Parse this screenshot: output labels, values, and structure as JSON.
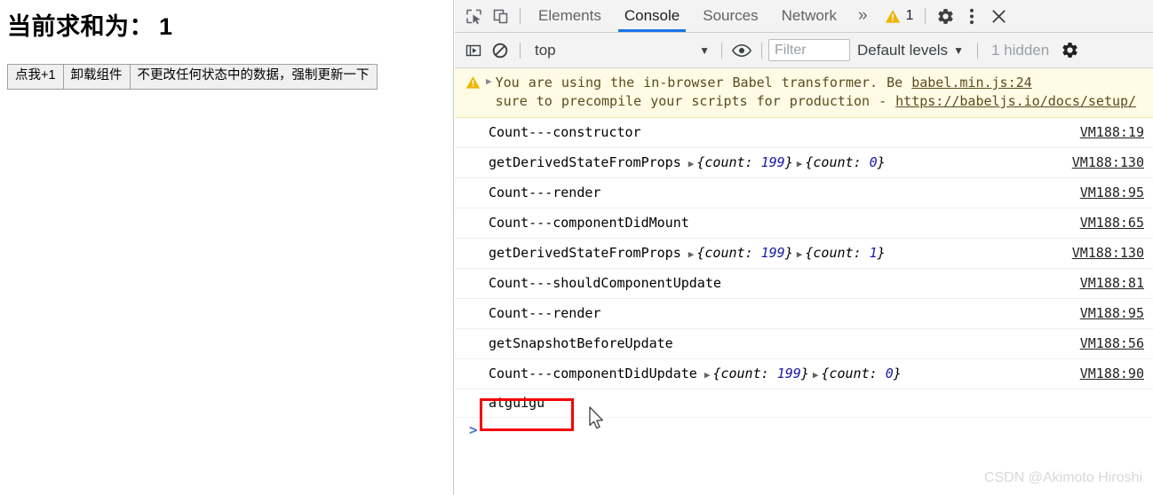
{
  "page": {
    "heading_label": "当前求和为：",
    "heading_value": "1",
    "buttons": [
      {
        "label": "点我+1",
        "name": "increment-button"
      },
      {
        "label": "卸载组件",
        "name": "unmount-component-button"
      },
      {
        "label": "不更改任何状态中的数据，强制更新一下",
        "name": "force-update-button"
      }
    ]
  },
  "devtools": {
    "tabs": [
      {
        "label": "Elements",
        "active": false
      },
      {
        "label": "Console",
        "active": true
      },
      {
        "label": "Sources",
        "active": false
      },
      {
        "label": "Network",
        "active": false
      }
    ],
    "more_tabs_glyph": "»",
    "warning_badge_count": "1",
    "icons": {
      "inspect": "inspect-element-icon",
      "device": "device-toolbar-icon",
      "warning": "warning-triangle-icon",
      "settings": "gear-icon",
      "kebab": "more-options-icon",
      "close": "close-icon",
      "sidebar": "console-sidebar-icon",
      "clear": "clear-console-icon",
      "eye": "live-expression-icon"
    },
    "filterbar": {
      "context_value": "top",
      "context_caret": "▼",
      "filter_placeholder": "Filter",
      "filter_value": "",
      "levels_label": "Default levels",
      "levels_caret": "▼",
      "hidden_label": "1 hidden"
    },
    "colors": {
      "accent": "#1a73e8",
      "warning_bg": "#fffbe5",
      "warning_icon": "#f0b400",
      "annotation": "#f40000",
      "number": "#1a1aa6",
      "prompt": "#4a76c4"
    },
    "messages": [
      {
        "type": "warning",
        "text_part1": "You are using the in-browser Babel transformer. Be",
        "text_part2": "sure to precompile your scripts for production - ",
        "link": "https://babeljs.io/docs/setup/",
        "source": "babel.min.js:24"
      },
      {
        "type": "log",
        "label": "Count---constructor",
        "objects": [],
        "source": "VM188:19"
      },
      {
        "type": "log",
        "label": "getDerivedStateFromProps",
        "objects": [
          {
            "key": "count",
            "value": "199"
          },
          {
            "key": "count",
            "value": "0"
          }
        ],
        "source": "VM188:130"
      },
      {
        "type": "log",
        "label": "Count---render",
        "objects": [],
        "source": "VM188:95"
      },
      {
        "type": "log",
        "label": "Count---componentDidMount",
        "objects": [],
        "source": "VM188:65"
      },
      {
        "type": "log",
        "label": "getDerivedStateFromProps",
        "objects": [
          {
            "key": "count",
            "value": "199"
          },
          {
            "key": "count",
            "value": "1"
          }
        ],
        "source": "VM188:130"
      },
      {
        "type": "log",
        "label": "Count---shouldComponentUpdate",
        "objects": [],
        "source": "VM188:81"
      },
      {
        "type": "log",
        "label": "Count---render",
        "objects": [],
        "source": "VM188:95"
      },
      {
        "type": "log",
        "label": "getSnapshotBeforeUpdate",
        "objects": [],
        "source": "VM188:56"
      },
      {
        "type": "log",
        "label": "Count---componentDidUpdate",
        "objects": [
          {
            "key": "count",
            "value": "199"
          },
          {
            "key": "count",
            "value": "0"
          }
        ],
        "source": "VM188:90"
      },
      {
        "type": "plain",
        "label": "atguigu",
        "objects": [],
        "source": ""
      }
    ],
    "prompt_glyph": ">"
  },
  "watermark": "CSDN @Akimoto Hiroshi"
}
